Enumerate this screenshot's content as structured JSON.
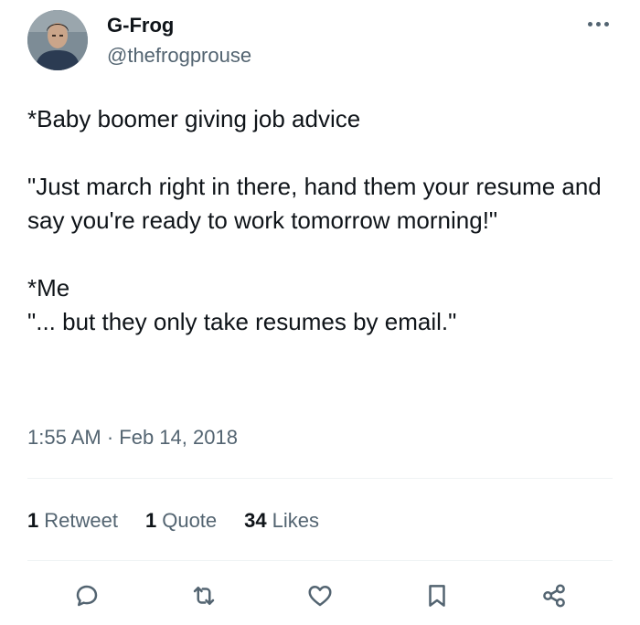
{
  "author": {
    "name": "G-Frog",
    "handle": "@thefrogprouse",
    "avatar_icon": "profile-photo"
  },
  "tweet": {
    "lines": [
      "*Baby boomer giving job advice",
      "",
      "\"Just march right in there, hand them your resume and say you're ready to work tomorrow morning!\"",
      "",
      "*Me",
      "\"... but they only take resumes by email.\""
    ],
    "timestamp": "1:55 AM · Feb 14, 2018"
  },
  "stats": {
    "retweets_count": "1",
    "retweets_label": "Retweet",
    "quotes_count": "1",
    "quotes_label": "Quote",
    "likes_count": "34",
    "likes_label": "Likes"
  },
  "actions": [
    "reply-icon",
    "retweet-icon",
    "like-icon",
    "bookmark-icon",
    "share-icon"
  ],
  "colors": {
    "text": "#0f1419",
    "secondary": "#536471",
    "divider": "#eff3f4"
  }
}
